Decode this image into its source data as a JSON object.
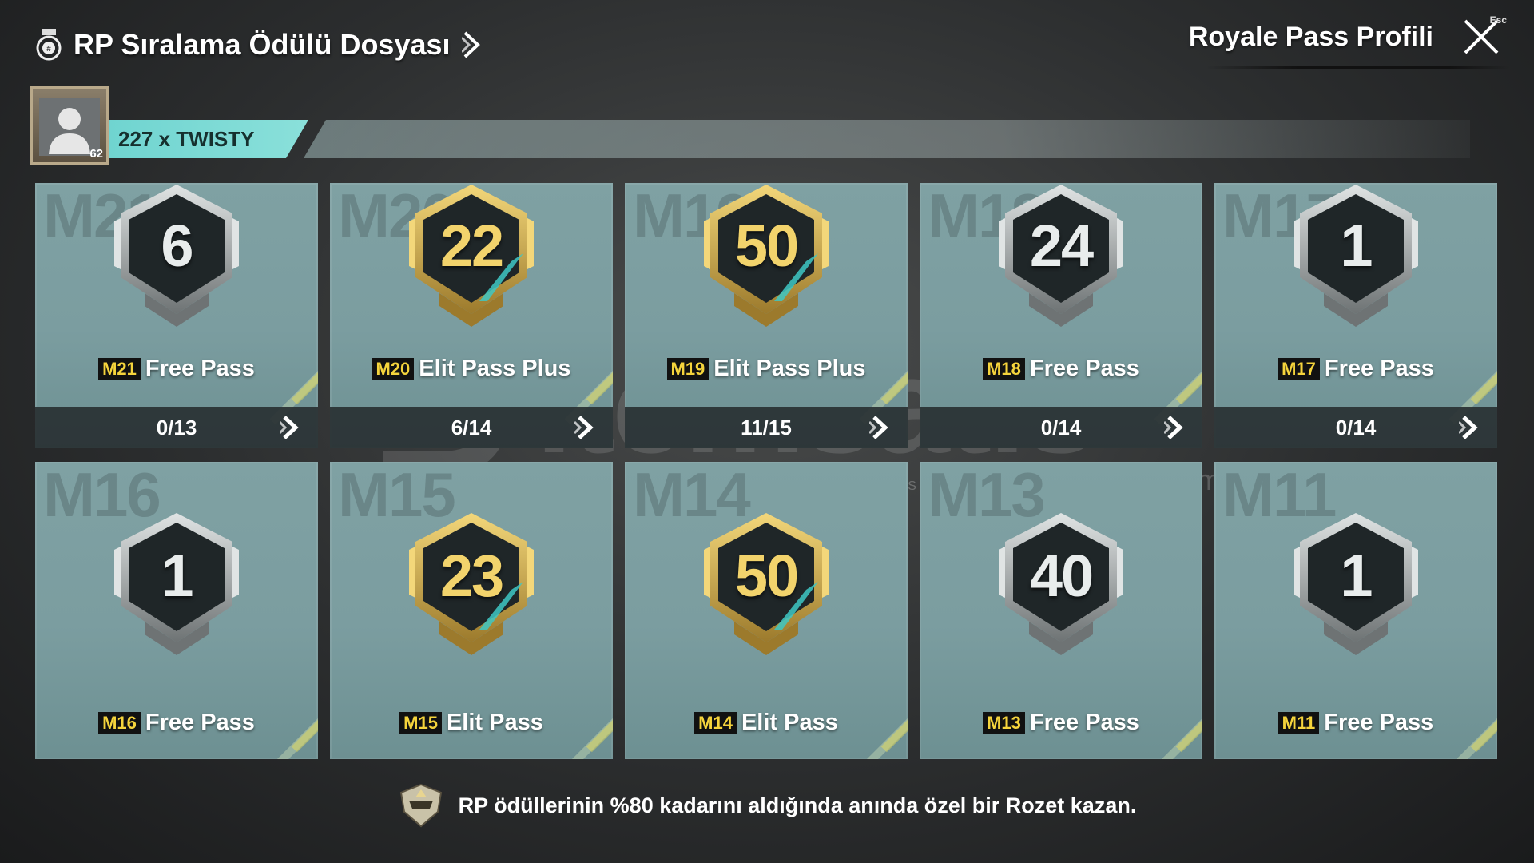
{
  "header": {
    "title": "RP Sıralama Ödülü Dosyası",
    "right_title": "Royale Pass Profili",
    "esc_label": "Esc"
  },
  "player": {
    "name": "227 x TWISTY",
    "level": "62"
  },
  "cards": [
    {
      "bg_code": "M21",
      "rank": "6",
      "tier": "silver",
      "season": "M21",
      "pass": "Free Pass",
      "progress": "0/13"
    },
    {
      "bg_code": "M20",
      "rank": "22",
      "tier": "gold",
      "season": "M20",
      "pass": "Elit Pass Plus",
      "progress": "6/14"
    },
    {
      "bg_code": "M19",
      "rank": "50",
      "tier": "gold",
      "season": "M19",
      "pass": "Elit Pass Plus",
      "progress": "11/15"
    },
    {
      "bg_code": "M18",
      "rank": "24",
      "tier": "silver",
      "season": "M18",
      "pass": "Free Pass",
      "progress": "0/14"
    },
    {
      "bg_code": "M17",
      "rank": "1",
      "tier": "silver",
      "season": "M17",
      "pass": "Free Pass",
      "progress": "0/14"
    },
    {
      "bg_code": "M16",
      "rank": "1",
      "tier": "silver",
      "season": "M16",
      "pass": "Free Pass"
    },
    {
      "bg_code": "M15",
      "rank": "23",
      "tier": "gold",
      "season": "M15",
      "pass": "Elit Pass"
    },
    {
      "bg_code": "M14",
      "rank": "50",
      "tier": "gold",
      "season": "M14",
      "pass": "Elit Pass"
    },
    {
      "bg_code": "M13",
      "rank": "40",
      "tier": "silver",
      "season": "M13",
      "pass": "Free Pass"
    },
    {
      "bg_code": "M11",
      "rank": "1",
      "tier": "silver",
      "season": "M11",
      "pass": "Free Pass"
    }
  ],
  "footer": {
    "text": "RP ödüllerinin %80 kadarını aldığında anında özel bir Rozet kazan."
  },
  "watermark": {
    "word": "itemsatis",
    "sub": "HESAP / SKIN / ITEM / E-PIN",
    "com": ".com"
  },
  "colors": {
    "accent_teal": "#6fd4d0",
    "season_tag_text": "#f5d43c",
    "card_bg": "#7b9da0",
    "gold": "#f2d36c"
  }
}
